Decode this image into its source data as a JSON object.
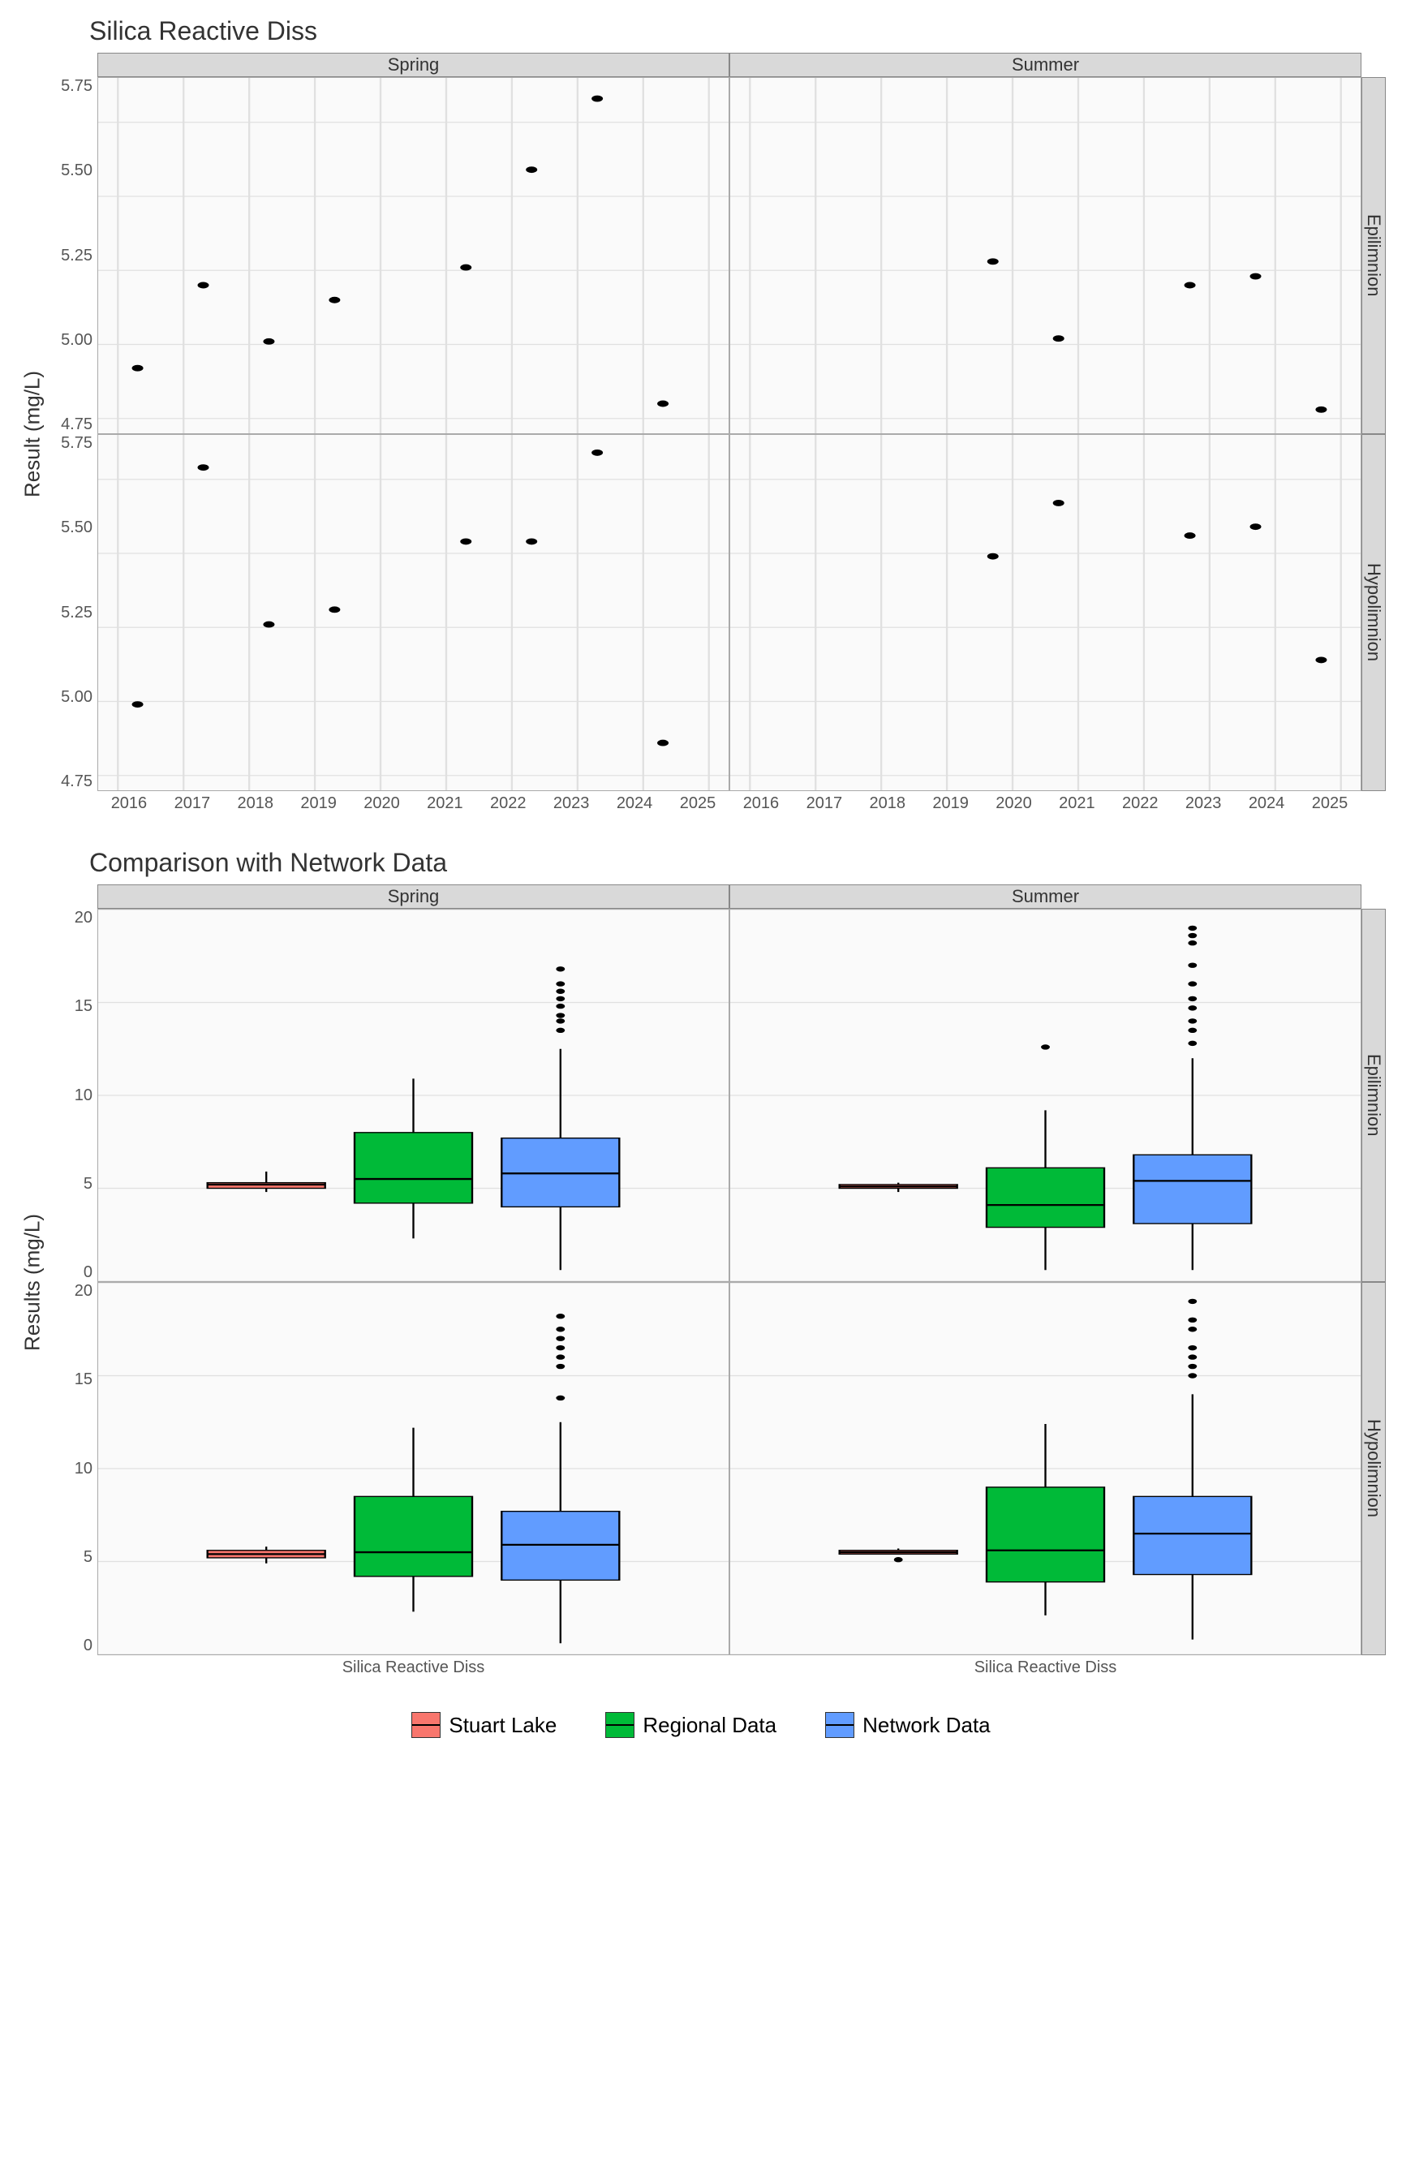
{
  "chart_data": [
    {
      "type": "scatter",
      "title": "Silica Reactive Diss",
      "ylabel": "Result (mg/L)",
      "col_facets": [
        "Spring",
        "Summer"
      ],
      "row_facets": [
        "Epilimnion",
        "Hypolimnion"
      ],
      "x_ticks": [
        2016,
        2017,
        2018,
        2019,
        2020,
        2021,
        2022,
        2023,
        2024,
        2025
      ],
      "y_ticks": [
        4.75,
        5.0,
        5.25,
        5.5,
        5.75
      ],
      "xlim": [
        2015.7,
        2025.3
      ],
      "ylim": [
        4.7,
        5.9
      ],
      "panels": {
        "Spring|Epilimnion": {
          "x": [
            2016.3,
            2017.3,
            2018.3,
            2019.3,
            2021.3,
            2022.3,
            2023.3,
            2024.3
          ],
          "y": [
            4.92,
            5.2,
            5.01,
            5.15,
            5.26,
            5.59,
            5.83,
            4.8
          ]
        },
        "Summer|Epilimnion": {
          "x": [
            2019.7,
            2020.7,
            2022.7,
            2023.7,
            2024.7
          ],
          "y": [
            5.28,
            5.02,
            5.2,
            5.23,
            4.78
          ]
        },
        "Spring|Hypolimnion": {
          "x": [
            2016.3,
            2017.3,
            2018.3,
            2019.3,
            2021.3,
            2022.3,
            2023.3,
            2024.3
          ],
          "y": [
            4.99,
            5.79,
            5.26,
            5.31,
            5.54,
            5.54,
            5.84,
            4.86
          ]
        },
        "Summer|Hypolimnion": {
          "x": [
            2019.7,
            2020.7,
            2022.7,
            2023.7,
            2024.7
          ],
          "y": [
            5.49,
            5.67,
            5.56,
            5.59,
            5.14
          ]
        }
      }
    },
    {
      "type": "box",
      "title": "Comparison with Network Data",
      "ylabel": "Results (mg/L)",
      "xlabel": "Silica Reactive Diss",
      "col_facets": [
        "Spring",
        "Summer"
      ],
      "row_facets": [
        "Epilimnion",
        "Hypolimnion"
      ],
      "y_ticks": [
        0,
        5,
        10,
        15,
        20
      ],
      "ylim": [
        0,
        20
      ],
      "groups": [
        "Stuart Lake",
        "Regional Data",
        "Network Data"
      ],
      "panels": {
        "Spring|Epilimnion": [
          {
            "group": "Stuart Lake",
            "min": 4.8,
            "q1": 5.0,
            "med": 5.2,
            "q3": 5.3,
            "max": 5.9,
            "out": []
          },
          {
            "group": "Regional Data",
            "min": 2.3,
            "q1": 4.2,
            "med": 5.5,
            "q3": 8.0,
            "max": 10.9,
            "out": []
          },
          {
            "group": "Network Data",
            "min": 0.6,
            "q1": 4.0,
            "med": 5.8,
            "q3": 7.7,
            "max": 12.5,
            "out": [
              13.5,
              14.0,
              14.3,
              14.8,
              15.2,
              15.6,
              16.0,
              16.8
            ]
          }
        ],
        "Summer|Epilimnion": [
          {
            "group": "Stuart Lake",
            "min": 4.8,
            "q1": 5.0,
            "med": 5.1,
            "q3": 5.2,
            "max": 5.3,
            "out": []
          },
          {
            "group": "Regional Data",
            "min": 0.6,
            "q1": 2.9,
            "med": 4.1,
            "q3": 6.1,
            "max": 9.2,
            "out": [
              12.6
            ]
          },
          {
            "group": "Network Data",
            "min": 0.6,
            "q1": 3.1,
            "med": 5.4,
            "q3": 6.8,
            "max": 12.0,
            "out": [
              12.8,
              13.5,
              14.0,
              14.7,
              15.2,
              16.0,
              17.0,
              18.2,
              18.6,
              19.0
            ]
          }
        ],
        "Spring|Hypolimnion": [
          {
            "group": "Stuart Lake",
            "min": 4.9,
            "q1": 5.2,
            "med": 5.4,
            "q3": 5.6,
            "max": 5.8,
            "out": []
          },
          {
            "group": "Regional Data",
            "min": 2.3,
            "q1": 4.2,
            "med": 5.5,
            "q3": 8.5,
            "max": 12.2,
            "out": []
          },
          {
            "group": "Network Data",
            "min": 0.6,
            "q1": 4.0,
            "med": 5.9,
            "q3": 7.7,
            "max": 12.5,
            "out": [
              13.8,
              15.5,
              16.0,
              16.5,
              17.0,
              17.5,
              18.2
            ]
          }
        ],
        "Summer|Hypolimnion": [
          {
            "group": "Stuart Lake",
            "min": 5.4,
            "q1": 5.4,
            "med": 5.5,
            "q3": 5.6,
            "max": 5.7,
            "out": [
              5.1
            ]
          },
          {
            "group": "Regional Data",
            "min": 2.1,
            "q1": 3.9,
            "med": 5.6,
            "q3": 9.0,
            "max": 12.4,
            "out": []
          },
          {
            "group": "Network Data",
            "min": 0.8,
            "q1": 4.3,
            "med": 6.5,
            "q3": 8.5,
            "max": 14.0,
            "out": [
              15.0,
              15.5,
              16.0,
              16.5,
              17.5,
              18.0,
              19.0
            ]
          }
        ]
      }
    }
  ],
  "legend": {
    "items": [
      {
        "label": "Stuart Lake",
        "color": "#F8766D"
      },
      {
        "label": "Regional Data",
        "color": "#00BA38"
      },
      {
        "label": "Network Data",
        "color": "#619CFF"
      }
    ]
  },
  "group_colors": {
    "Stuart Lake": "#F8766D",
    "Regional Data": "#00BA38",
    "Network Data": "#619CFF"
  }
}
